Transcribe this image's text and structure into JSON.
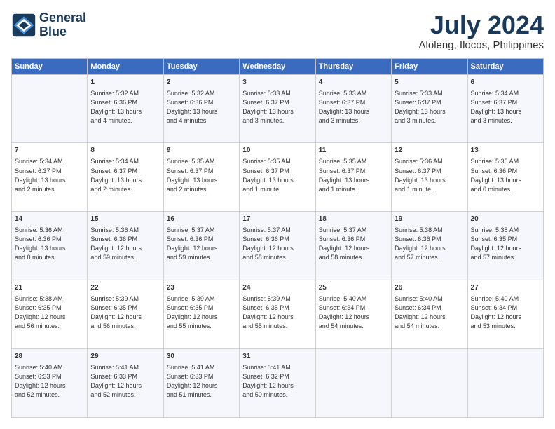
{
  "logo": {
    "line1": "General",
    "line2": "Blue"
  },
  "title": "July 2024",
  "subtitle": "Aloleng, Ilocos, Philippines",
  "headers": [
    "Sunday",
    "Monday",
    "Tuesday",
    "Wednesday",
    "Thursday",
    "Friday",
    "Saturday"
  ],
  "weeks": [
    [
      {
        "day": "",
        "info": ""
      },
      {
        "day": "1",
        "info": "Sunrise: 5:32 AM\nSunset: 6:36 PM\nDaylight: 13 hours\nand 4 minutes."
      },
      {
        "day": "2",
        "info": "Sunrise: 5:32 AM\nSunset: 6:36 PM\nDaylight: 13 hours\nand 4 minutes."
      },
      {
        "day": "3",
        "info": "Sunrise: 5:33 AM\nSunset: 6:37 PM\nDaylight: 13 hours\nand 3 minutes."
      },
      {
        "day": "4",
        "info": "Sunrise: 5:33 AM\nSunset: 6:37 PM\nDaylight: 13 hours\nand 3 minutes."
      },
      {
        "day": "5",
        "info": "Sunrise: 5:33 AM\nSunset: 6:37 PM\nDaylight: 13 hours\nand 3 minutes."
      },
      {
        "day": "6",
        "info": "Sunrise: 5:34 AM\nSunset: 6:37 PM\nDaylight: 13 hours\nand 3 minutes."
      }
    ],
    [
      {
        "day": "7",
        "info": "Sunrise: 5:34 AM\nSunset: 6:37 PM\nDaylight: 13 hours\nand 2 minutes."
      },
      {
        "day": "8",
        "info": "Sunrise: 5:34 AM\nSunset: 6:37 PM\nDaylight: 13 hours\nand 2 minutes."
      },
      {
        "day": "9",
        "info": "Sunrise: 5:35 AM\nSunset: 6:37 PM\nDaylight: 13 hours\nand 2 minutes."
      },
      {
        "day": "10",
        "info": "Sunrise: 5:35 AM\nSunset: 6:37 PM\nDaylight: 13 hours\nand 1 minute."
      },
      {
        "day": "11",
        "info": "Sunrise: 5:35 AM\nSunset: 6:37 PM\nDaylight: 13 hours\nand 1 minute."
      },
      {
        "day": "12",
        "info": "Sunrise: 5:36 AM\nSunset: 6:37 PM\nDaylight: 13 hours\nand 1 minute."
      },
      {
        "day": "13",
        "info": "Sunrise: 5:36 AM\nSunset: 6:36 PM\nDaylight: 13 hours\nand 0 minutes."
      }
    ],
    [
      {
        "day": "14",
        "info": "Sunrise: 5:36 AM\nSunset: 6:36 PM\nDaylight: 13 hours\nand 0 minutes."
      },
      {
        "day": "15",
        "info": "Sunrise: 5:36 AM\nSunset: 6:36 PM\nDaylight: 12 hours\nand 59 minutes."
      },
      {
        "day": "16",
        "info": "Sunrise: 5:37 AM\nSunset: 6:36 PM\nDaylight: 12 hours\nand 59 minutes."
      },
      {
        "day": "17",
        "info": "Sunrise: 5:37 AM\nSunset: 6:36 PM\nDaylight: 12 hours\nand 58 minutes."
      },
      {
        "day": "18",
        "info": "Sunrise: 5:37 AM\nSunset: 6:36 PM\nDaylight: 12 hours\nand 58 minutes."
      },
      {
        "day": "19",
        "info": "Sunrise: 5:38 AM\nSunset: 6:36 PM\nDaylight: 12 hours\nand 57 minutes."
      },
      {
        "day": "20",
        "info": "Sunrise: 5:38 AM\nSunset: 6:35 PM\nDaylight: 12 hours\nand 57 minutes."
      }
    ],
    [
      {
        "day": "21",
        "info": "Sunrise: 5:38 AM\nSunset: 6:35 PM\nDaylight: 12 hours\nand 56 minutes."
      },
      {
        "day": "22",
        "info": "Sunrise: 5:39 AM\nSunset: 6:35 PM\nDaylight: 12 hours\nand 56 minutes."
      },
      {
        "day": "23",
        "info": "Sunrise: 5:39 AM\nSunset: 6:35 PM\nDaylight: 12 hours\nand 55 minutes."
      },
      {
        "day": "24",
        "info": "Sunrise: 5:39 AM\nSunset: 6:35 PM\nDaylight: 12 hours\nand 55 minutes."
      },
      {
        "day": "25",
        "info": "Sunrise: 5:40 AM\nSunset: 6:34 PM\nDaylight: 12 hours\nand 54 minutes."
      },
      {
        "day": "26",
        "info": "Sunrise: 5:40 AM\nSunset: 6:34 PM\nDaylight: 12 hours\nand 54 minutes."
      },
      {
        "day": "27",
        "info": "Sunrise: 5:40 AM\nSunset: 6:34 PM\nDaylight: 12 hours\nand 53 minutes."
      }
    ],
    [
      {
        "day": "28",
        "info": "Sunrise: 5:40 AM\nSunset: 6:33 PM\nDaylight: 12 hours\nand 52 minutes."
      },
      {
        "day": "29",
        "info": "Sunrise: 5:41 AM\nSunset: 6:33 PM\nDaylight: 12 hours\nand 52 minutes."
      },
      {
        "day": "30",
        "info": "Sunrise: 5:41 AM\nSunset: 6:33 PM\nDaylight: 12 hours\nand 51 minutes."
      },
      {
        "day": "31",
        "info": "Sunrise: 5:41 AM\nSunset: 6:32 PM\nDaylight: 12 hours\nand 50 minutes."
      },
      {
        "day": "",
        "info": ""
      },
      {
        "day": "",
        "info": ""
      },
      {
        "day": "",
        "info": ""
      }
    ]
  ]
}
